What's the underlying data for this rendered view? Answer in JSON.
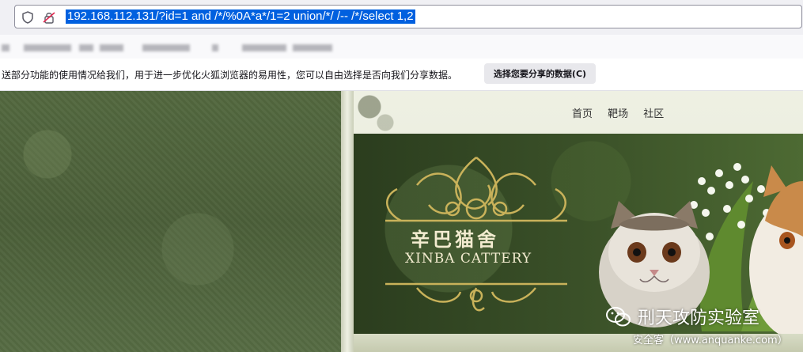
{
  "address_bar": {
    "url": "192.168.112.131/?id=1 and /*/%0A*a*/1=2 union/*/ /-- /*/select 1,2",
    "shield_icon": "shield-icon",
    "lock_icon": "insecure-lock-icon"
  },
  "notification": {
    "message": "送部分功能的使用情况给我们，用于进一步优化火狐浏览器的易用性，您可以自由选择是否向我们分享数据。",
    "button_label": "选择您要分享的数据(C)"
  },
  "site": {
    "nav": [
      "首页",
      "靶场",
      "社区"
    ],
    "logo_cn": "辛巴猫舍",
    "logo_en": "XINBA CATTERY"
  },
  "watermark": {
    "name": "刑天攻防实验室",
    "source": "安全客（www.anquanke.com）",
    "icon": "wechat-icon"
  },
  "colors": {
    "url_highlight": "#0060df",
    "page_left_bg": "#4b5f39",
    "banner_dark": "#2b3d1e",
    "logo_gold": "#c9b25a"
  }
}
